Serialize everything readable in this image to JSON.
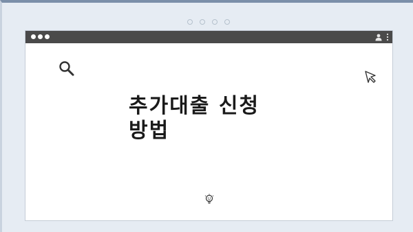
{
  "window": {
    "headline": "추가대출 신청\n방법"
  },
  "icons": {
    "traffic": "window-control-dots",
    "user": "user-icon",
    "menu": "kebab-icon",
    "search": "search-icon",
    "cursor": "cursor-arrow-icon",
    "bulb": "lightbulb-icon",
    "pager": "pagination-dots"
  },
  "colors": {
    "background": "#e6ecf3",
    "titlebar": "#4a4a4a",
    "headline": "#1a1a1a"
  }
}
